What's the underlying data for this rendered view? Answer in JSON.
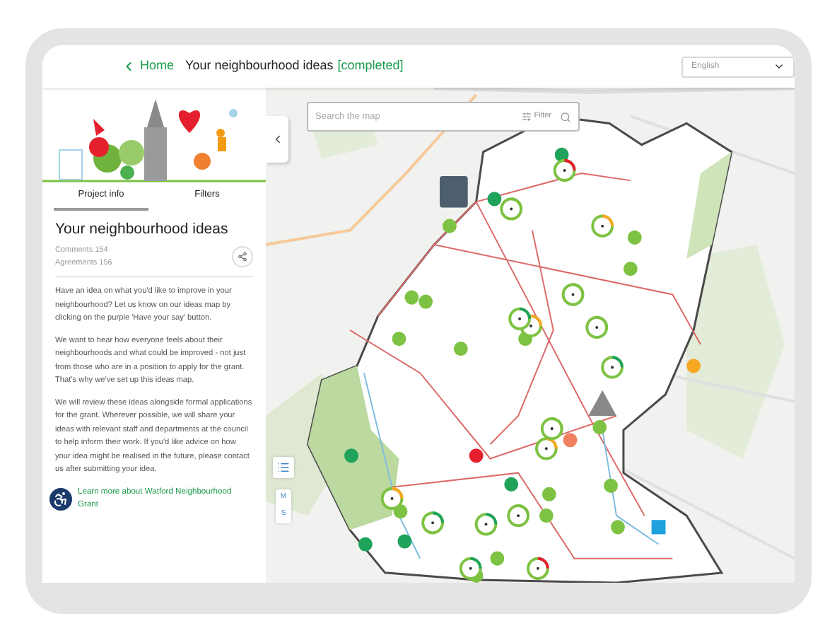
{
  "header": {
    "back_link": "Home",
    "title": "Your neighbourhood ideas",
    "status": "[completed]",
    "language": "English"
  },
  "sidebar": {
    "tabs": [
      {
        "label": "Project info",
        "selected": true
      },
      {
        "label": "Filters",
        "selected": false
      }
    ],
    "title": "Your neighbourhood ideas",
    "stats": [
      "Comments 154",
      "Agreements 156"
    ],
    "paragraphs": [
      "Have an idea on what you'd like to improve in your neighbourhood? Let us know on our ideas map by clicking on the purple 'Have your say' button.",
      "We want to hear how everyone feels about their neighbourhoods and what could be improved - not just from those who are in a position to apply for the grant. That's why we've set up this ideas map.",
      "We will review these ideas alongside formal applications for the grant. Wherever possible, we will share your ideas with relevant staff and departments at the council to help inform their work. If you'd like advice on how your idea might be realised in the future, please contact us after submitting your idea."
    ],
    "link": "Learn more about Watford Neighbourhood Grant"
  },
  "map": {
    "search": {
      "placeholder": "Search the map",
      "filter": "Filter"
    },
    "controls": [
      "M",
      "S"
    ]
  }
}
